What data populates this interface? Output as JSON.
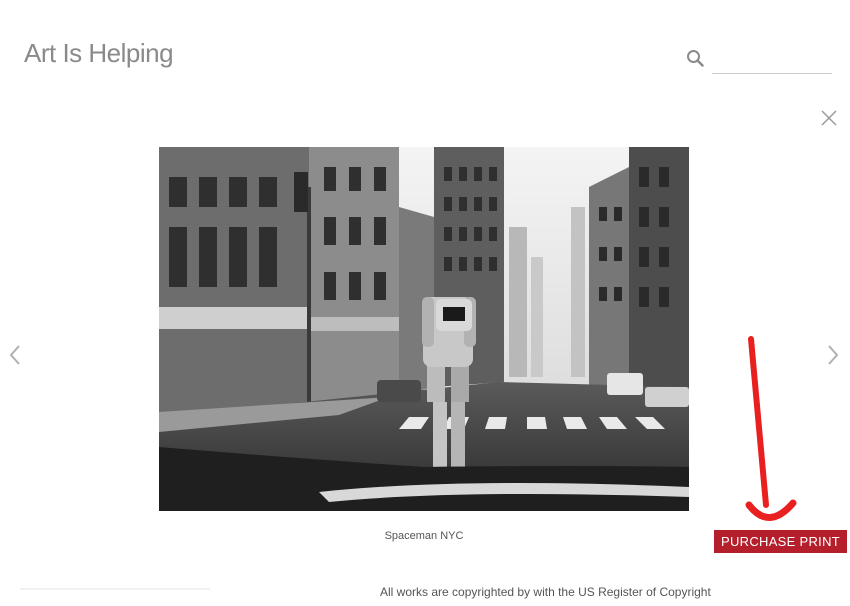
{
  "header": {
    "site_title": "Art Is Helping",
    "search": {
      "placeholder": "",
      "value": ""
    }
  },
  "lightbox": {
    "photo": {
      "description_icon": "photo-spaceman-nyc"
    },
    "caption": "Spaceman NYC",
    "purchase_label": "PURCHASE PRINT"
  },
  "footer": {
    "copyright": "All works are copyrighted by with the US Register of Copyright"
  },
  "colors": {
    "accent": "#b51f2b",
    "annotation_arrow": "#e8201f",
    "title_gray": "#8a8a8a"
  }
}
